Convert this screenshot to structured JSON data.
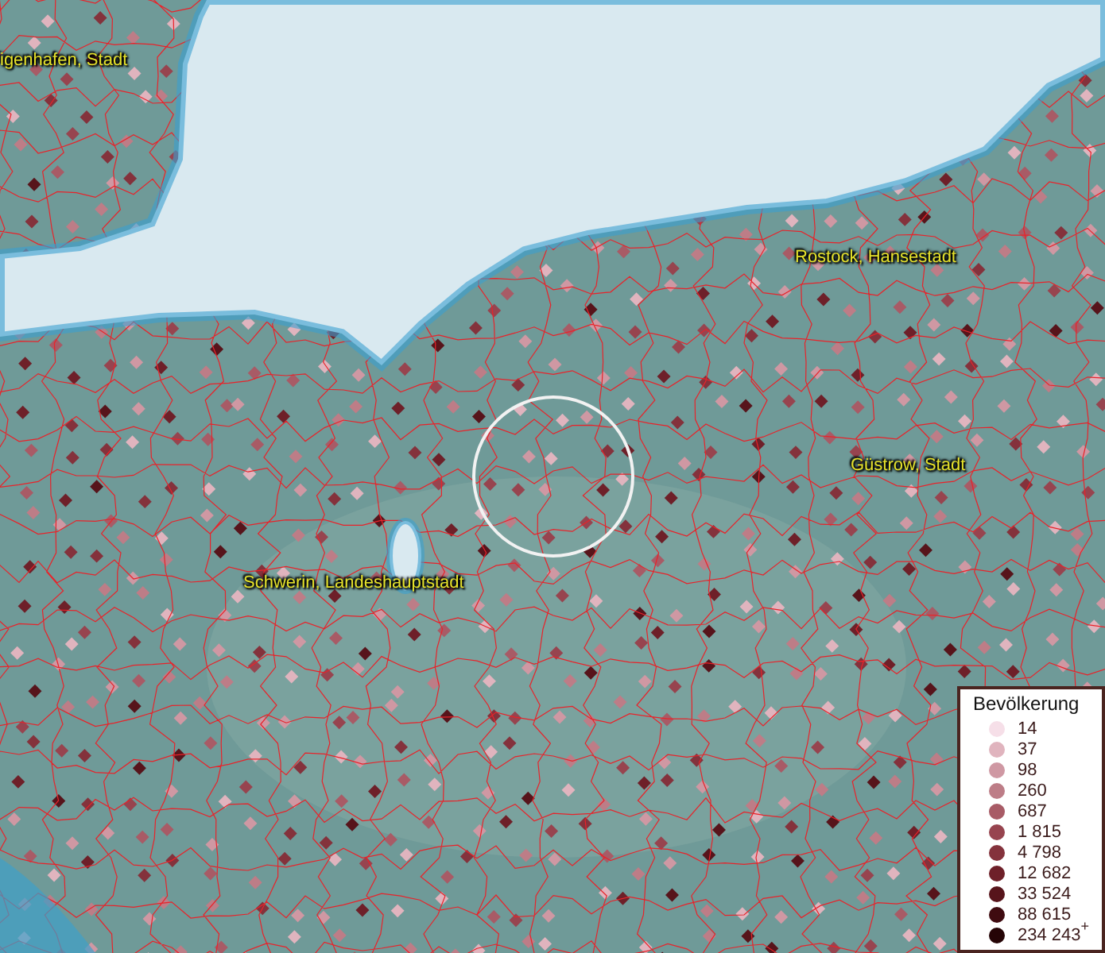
{
  "place_labels": [
    {
      "text": "igenhafen, Stadt"
    },
    {
      "text": "Rostock, Hansestadt"
    },
    {
      "text": "Güstrow, Stadt"
    },
    {
      "text": "Schwerin, Landeshauptstadt"
    }
  ],
  "legend": {
    "title": "Bevölkerung",
    "items": [
      {
        "label": "14",
        "color": "#f6dfe8"
      },
      {
        "label": "37",
        "color": "#e0b4be"
      },
      {
        "label": "98",
        "color": "#cf98a3"
      },
      {
        "label": "260",
        "color": "#bd7d87"
      },
      {
        "label": "687",
        "color": "#a85b66"
      },
      {
        "label": "1 815",
        "color": "#97444f"
      },
      {
        "label": "4 798",
        "color": "#84323c"
      },
      {
        "label": "12 682",
        "color": "#6e2029"
      },
      {
        "label": "33 524",
        "color": "#57141b"
      },
      {
        "label": "88 615",
        "color": "#3f0b10"
      },
      {
        "label": "234 243$^{+}$",
        "color": "#250406"
      }
    ]
  }
}
